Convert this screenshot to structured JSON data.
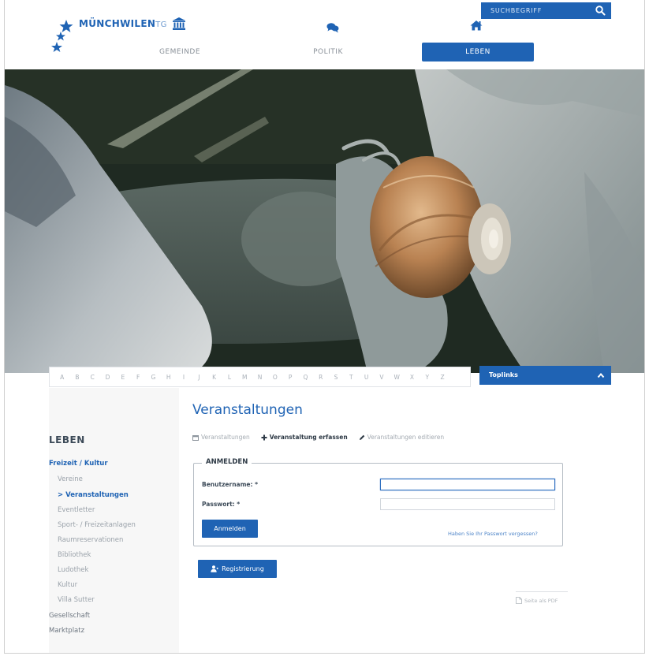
{
  "header": {
    "logo_text": "MÜNCHWILEN",
    "logo_suffix": "TG",
    "search_placeholder": "SUCHBEGRIFF",
    "nav": [
      {
        "label": "GEMEINDE",
        "icon": "building-icon"
      },
      {
        "label": "POLITIK",
        "icon": "chat-bubbles-icon"
      },
      {
        "label": "LEBEN",
        "icon": "home-icon",
        "active": true
      }
    ]
  },
  "alphabet": [
    "A",
    "B",
    "C",
    "D",
    "E",
    "F",
    "G",
    "H",
    "I",
    "J",
    "K",
    "L",
    "M",
    "N",
    "O",
    "P",
    "Q",
    "R",
    "S",
    "T",
    "U",
    "V",
    "W",
    "X",
    "Y",
    "Z"
  ],
  "toplinks_label": "Toplinks",
  "sidebar": {
    "title": "LEBEN",
    "category": "Freizeit / Kultur",
    "items": [
      "Vereine",
      "> Veranstaltungen",
      "Eventletter",
      "Sport- / Freizeitanlagen",
      "Raumreservationen",
      "Bibliothek",
      "Ludothek",
      "Kultur",
      "Villa Sutter"
    ],
    "top_items": [
      "Gesellschaft",
      "Marktplatz"
    ]
  },
  "main": {
    "title": "Veranstaltungen",
    "tabs": [
      {
        "label": "Veranstaltungen",
        "icon": "calendar-icon"
      },
      {
        "label": "Veranstaltung erfassen",
        "icon": "plus-icon",
        "selected": true
      },
      {
        "label": "Veranstaltungen editieren",
        "icon": "pencil-icon"
      }
    ],
    "login": {
      "legend": "ANMELDEN",
      "username_label": "Benutzername: *",
      "username_value": "",
      "password_label": "Passwort: *",
      "password_value": "",
      "submit_label": "Anmelden",
      "forgot_label": "Haben Sie Ihr Passwort vergessen?"
    },
    "register_label": "Registrierung",
    "pdf_label": "Seite als PDF"
  },
  "colors": {
    "brand_blue": "#1f63b4",
    "sidebar_bg": "#f7f7f7"
  }
}
